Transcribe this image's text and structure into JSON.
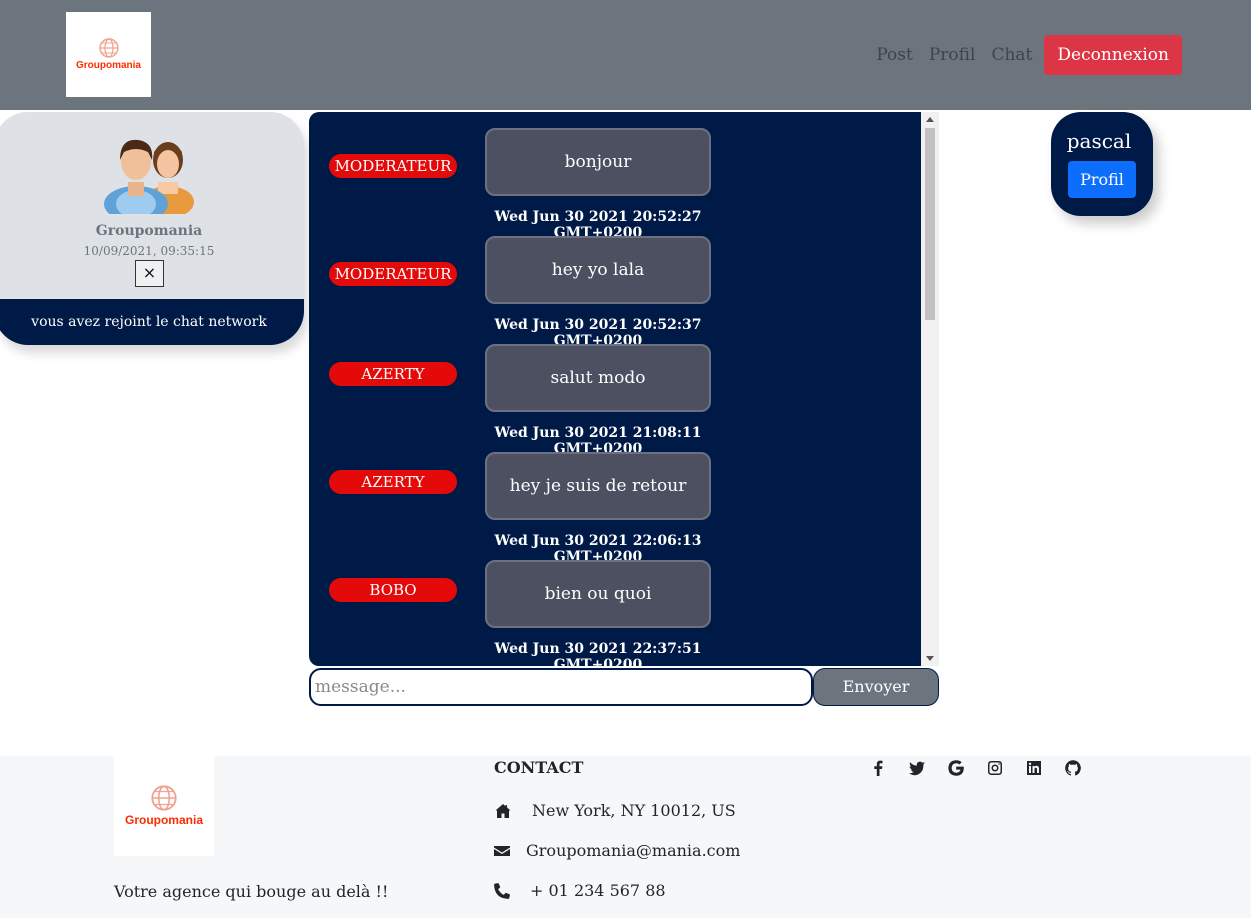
{
  "header": {
    "logo_text": "Groupomania",
    "nav": {
      "post": "Post",
      "profil": "Profil",
      "chat": "Chat",
      "logout": "Deconnexion"
    }
  },
  "left_card": {
    "name": "Groupomania",
    "date": "10/09/2021, 09:35:15",
    "close_symbol": "×",
    "footer_text": "vous avez rejoint le chat network"
  },
  "messages": [
    {
      "author": "MODERATEUR",
      "text": "bonjour",
      "time": "Wed Jun 30 2021 20:52:27 GMT+0200"
    },
    {
      "author": "MODERATEUR",
      "text": "hey yo lala",
      "time": "Wed Jun 30 2021 20:52:37 GMT+0200"
    },
    {
      "author": "AZERTY",
      "text": "salut modo",
      "time": "Wed Jun 30 2021 21:08:11 GMT+0200"
    },
    {
      "author": "AZERTY",
      "text": "hey je suis de retour",
      "time": "Wed Jun 30 2021 22:06:13 GMT+0200"
    },
    {
      "author": "BOBO",
      "text": "bien ou quoi",
      "time": "Wed Jun 30 2021 22:37:51 GMT+0200"
    }
  ],
  "composer": {
    "placeholder": "message...",
    "send_label": "Envoyer"
  },
  "user_card": {
    "name": "pascal",
    "button": "Profil"
  },
  "footer": {
    "logo_text": "Groupomania",
    "tagline": "Votre agence qui bouge au delà !!",
    "contact_title": "CONTACT",
    "address": "New York, NY 10012, US",
    "email": "Groupomania@mania.com",
    "phone": "+ 01 234 567 88",
    "socials": [
      "facebook-icon",
      "twitter-icon",
      "google-icon",
      "instagram-icon",
      "linkedin-icon",
      "github-icon"
    ]
  },
  "colors": {
    "navy": "#001a47",
    "header_gray": "#6c757d",
    "danger": "#dc3545",
    "badge_red": "#e40a0a",
    "primary": "#0d6efd",
    "brand": "#fd2d01"
  }
}
